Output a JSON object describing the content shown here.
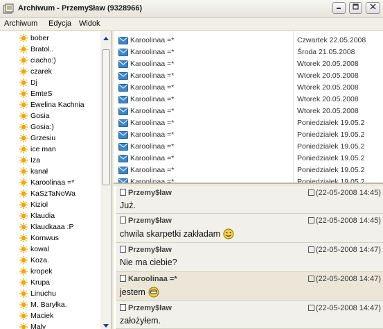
{
  "window": {
    "title": "Archiwum - Przemy$ław (9328966)"
  },
  "menu": {
    "archiwum": "Archiwum",
    "edycja": "Edycja",
    "widok": "Widok"
  },
  "contacts": [
    "bober",
    "Bratol..",
    "ciacho:)",
    "czarek",
    "Dj",
    "EmteS",
    "Ewelina Kachnia",
    "Gosia",
    "Gosia:)",
    "Grzesiu",
    "ice man",
    "Iza",
    "kanał",
    "Karoolinaa =*",
    "KaSzTaNoWa",
    "Kiziol",
    "Klaudia",
    "Klaudkaaa :P",
    "Kornwus",
    "kowal",
    "Koza.",
    "kropek",
    "Krupa",
    "Linuchu",
    "M. Baryłka.",
    "Maciek",
    "Maly"
  ],
  "messages": [
    {
      "sender": "Karoolinaa =*",
      "date": "Czwartek 22.05.2008"
    },
    {
      "sender": "Karoolinaa =*",
      "date": "Środa 21.05.2008"
    },
    {
      "sender": "Karoolinaa =*",
      "date": "Wtorek 20.05.2008"
    },
    {
      "sender": "Karoolinaa =*",
      "date": "Wtorek 20.05.2008"
    },
    {
      "sender": "Karoolinaa =*",
      "date": "Wtorek 20.05.2008"
    },
    {
      "sender": "Karoolinaa =*",
      "date": "Wtorek 20.05.2008"
    },
    {
      "sender": "Karoolinaa =*",
      "date": "Wtorek 20.05.2008"
    },
    {
      "sender": "Karoolinaa =*",
      "date": "Poniedziałek 19.05.2"
    },
    {
      "sender": "Karoolinaa =*",
      "date": "Poniedziałek 19.05.2"
    },
    {
      "sender": "Karoolinaa =*",
      "date": "Poniedziałek 19.05.2"
    },
    {
      "sender": "Karoolinaa =*",
      "date": "Poniedziałek 19.05.2"
    },
    {
      "sender": "Karoolinaa =*",
      "date": "Poniedziałek 19.05.2"
    },
    {
      "sender": "Karoolinaa =*",
      "date": "Poniedziałek 19.05.2"
    }
  ],
  "conversation": [
    {
      "author": "Przemy$ław",
      "time": "(22-05-2008 14:45)",
      "text": "Już.",
      "direction": "out"
    },
    {
      "author": "Przemy$ław",
      "time": "(22-05-2008 14:45)",
      "text": "chwila skarpetki zakładam",
      "direction": "out",
      "emoticon": "smile-emoticon"
    },
    {
      "author": "Przemy$ław",
      "time": "(22-05-2008 14:47)",
      "text": "Nie ma ciebie?",
      "direction": "out"
    },
    {
      "author": "Karoolinaa =*",
      "time": "(22-05-2008 14:47)",
      "text": "jestem",
      "direction": "in",
      "emoticon": "grin-emoticon"
    },
    {
      "author": "Przemy$ław",
      "time": "(22-05-2008 14:47)",
      "text": "założyłem.",
      "direction": "out"
    }
  ],
  "colors": {
    "contact_status": "#f0a800",
    "envelope": "#3f86c8",
    "incoming_bg": "#ebe6d8",
    "outgoing_bg": "#f1f0ea"
  }
}
